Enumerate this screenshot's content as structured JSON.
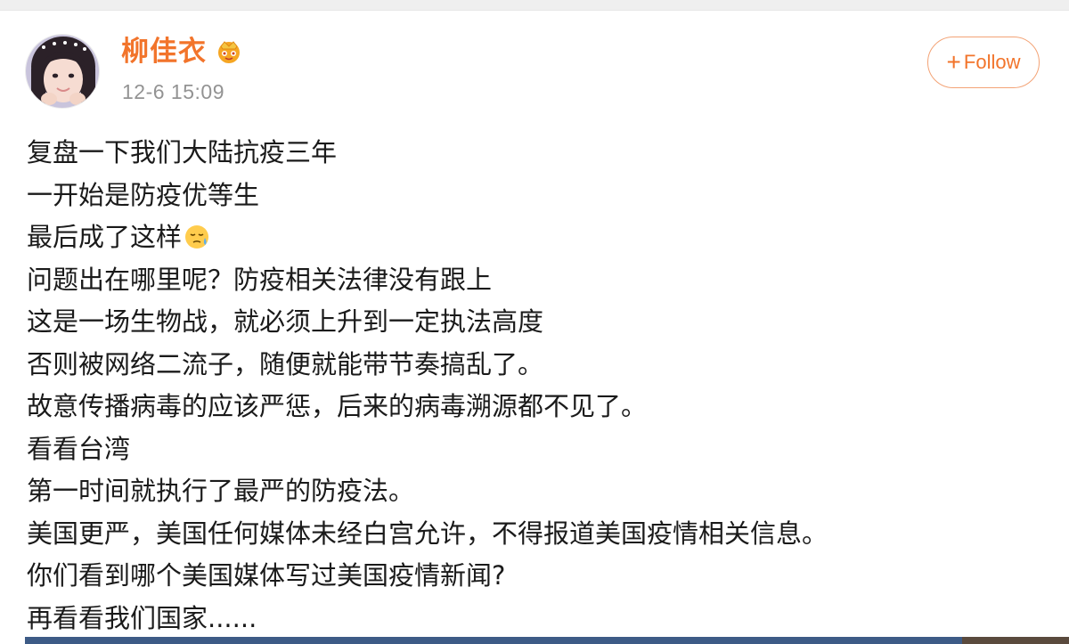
{
  "post": {
    "author": {
      "name": "柳佳衣",
      "badge_icon": "vip-crown-icon"
    },
    "timestamp": "12-6 15:09",
    "follow_button": {
      "plus": "+",
      "label": "Follow"
    },
    "lines": [
      "复盘一下我们大陆抗疫三年",
      "一开始是防疫优等生",
      "最后成了这样",
      "问题出在哪里呢？防疫相关法律没有跟上",
      "这是一场生物战，就必须上升到一定执法高度",
      "否则被网络二流子，随便就能带节奏搞乱了。",
      "故意传播病毒的应该严惩，后来的病毒溯源都不见了。",
      "看看台湾",
      "第一时间就执行了最严的防疫法。",
      "美国更严，美国任何媒体未经白宫允许，不得报道美国疫情相关信息。",
      "你们看到哪个美国媒体写过美国疫情新闻?",
      "再看看我们国家......"
    ],
    "inline_emoji": "sweat-face-emoji"
  },
  "colors": {
    "username": "#f2742b",
    "follow_border": "#f3a376",
    "timestamp": "#939393",
    "text": "#1a1a1a"
  }
}
